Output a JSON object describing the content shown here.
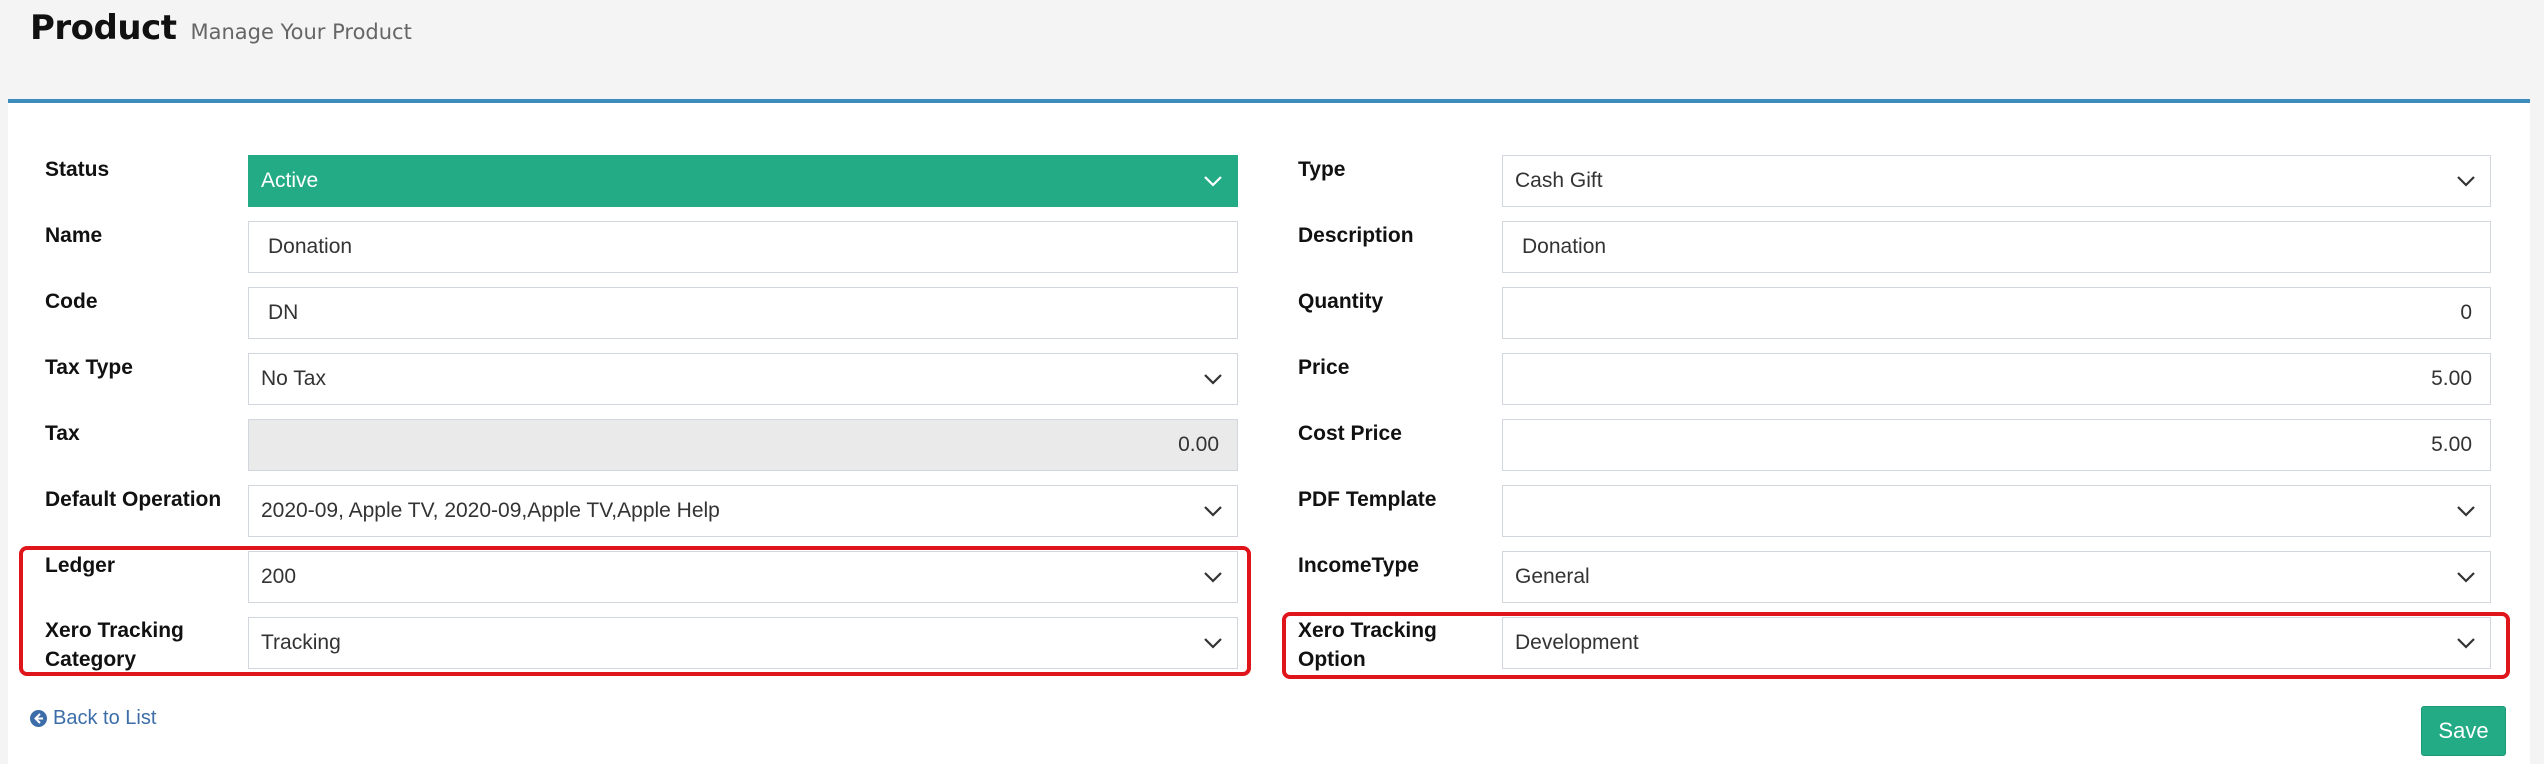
{
  "header": {
    "title": "Product",
    "subtitle": "Manage Your Product"
  },
  "left": {
    "status": {
      "label": "Status",
      "value": "Active"
    },
    "name": {
      "label": "Name",
      "value": "Donation"
    },
    "code": {
      "label": "Code",
      "value": "DN"
    },
    "tax_type": {
      "label": "Tax Type",
      "value": "No Tax"
    },
    "tax": {
      "label": "Tax",
      "value": "0.00"
    },
    "default_operation": {
      "label": "Default Operation",
      "value": "2020-09, Apple TV, 2020-09,Apple TV,Apple Help"
    },
    "ledger": {
      "label": "Ledger",
      "value": "200"
    },
    "xero_tracking_category": {
      "label_line1": "Xero Tracking",
      "label_line2": "Category",
      "value": "Tracking"
    }
  },
  "right": {
    "type": {
      "label": "Type",
      "value": "Cash Gift"
    },
    "description": {
      "label": "Description",
      "value": "Donation"
    },
    "quantity": {
      "label": "Quantity",
      "value": "0"
    },
    "price": {
      "label": "Price",
      "value": "5.00"
    },
    "cost_price": {
      "label": "Cost Price",
      "value": "5.00"
    },
    "pdf_template": {
      "label": "PDF Template",
      "value": ""
    },
    "income_type": {
      "label": "IncomeType",
      "value": "General"
    },
    "xero_tracking_option": {
      "label_line1": "Xero Tracking",
      "label_line2": "Option",
      "value": "Development"
    }
  },
  "footer": {
    "back_label": "Back to List",
    "save_label": "Save"
  },
  "colors": {
    "accent_green": "#22ab84",
    "box_top_border": "#3c8dbc",
    "highlight_red": "#e0141b",
    "link_blue": "#3c6da8"
  },
  "icons": {
    "select_arrow": "chevron-down-icon",
    "back": "arrow-circle-left-icon"
  }
}
